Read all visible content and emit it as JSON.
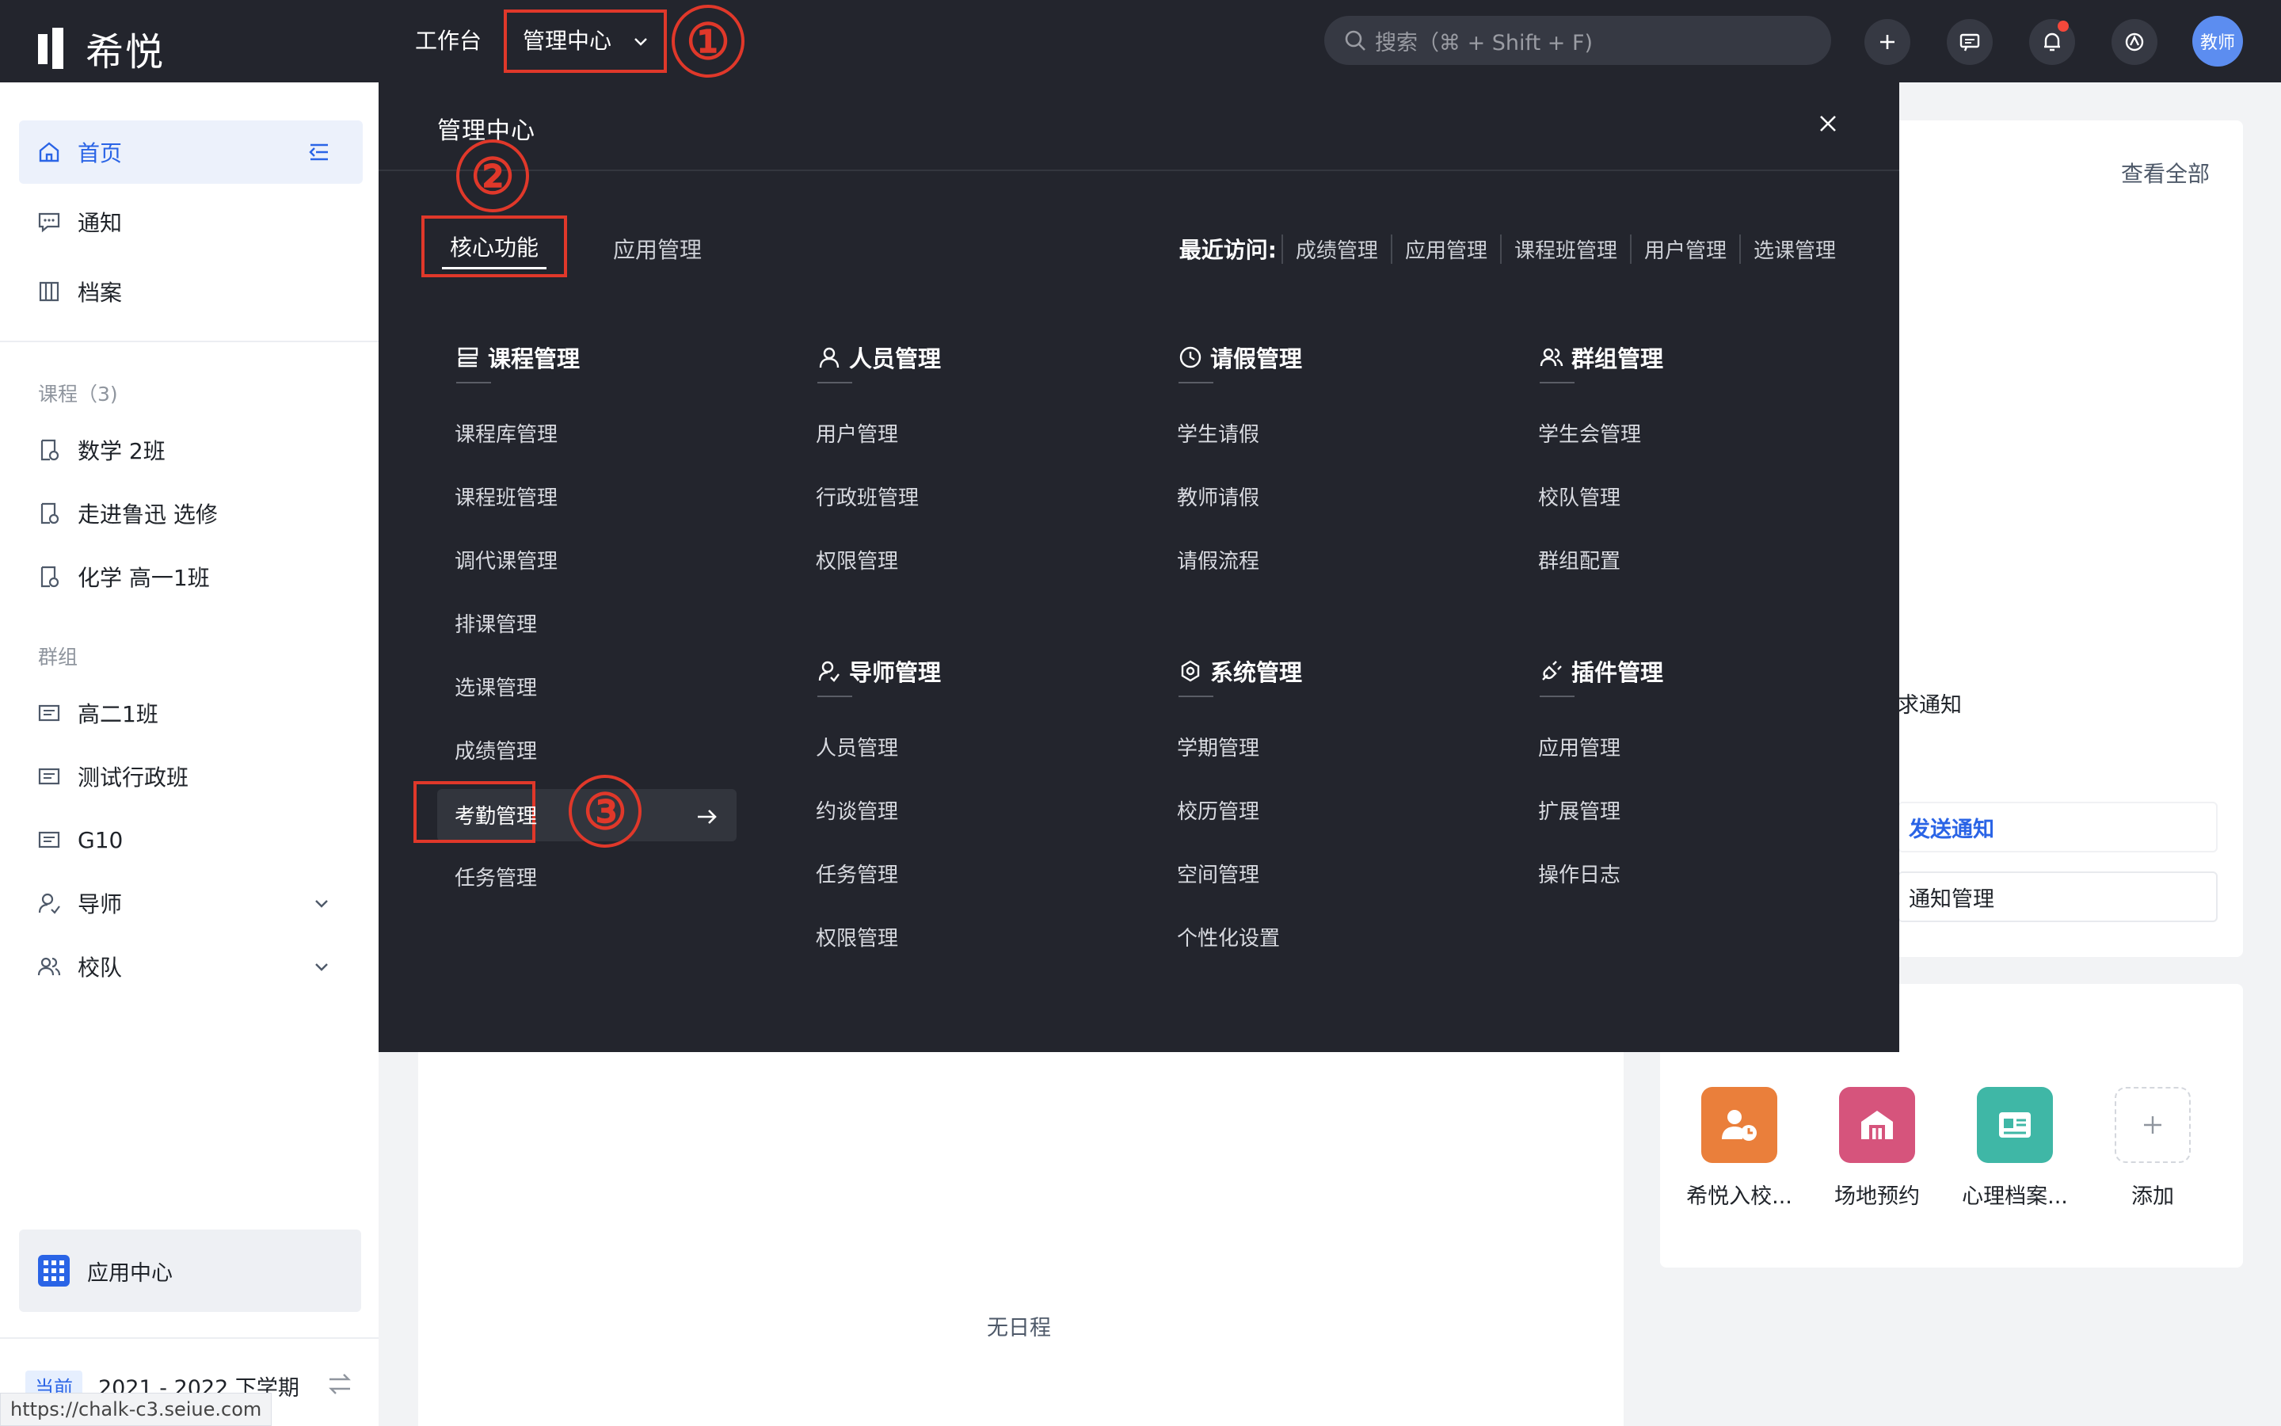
{
  "topbar": {
    "logo_text": "希悦",
    "nav": {
      "workbench": "工作台",
      "admin_center": "管理中心"
    },
    "search_placeholder": "搜索（⌘ + Shift + F)",
    "avatar": "教师",
    "icons": [
      "plus-icon",
      "message-icon",
      "bell-icon",
      "assistant-icon"
    ]
  },
  "annotations": {
    "one": "①",
    "two": "②",
    "three": "③",
    "color": "#e0382a"
  },
  "sidebar": {
    "top_items": [
      {
        "label": "首页",
        "icon": "home-icon",
        "active": true
      },
      {
        "label": "通知",
        "icon": "chat-bubble-icon"
      },
      {
        "label": "档案",
        "icon": "archive-icon"
      }
    ],
    "courses_title": "课程（3)",
    "courses": [
      {
        "label": "数学 2班"
      },
      {
        "label": "走进鲁迅 选修"
      },
      {
        "label": "化学 高一1班"
      }
    ],
    "groups_title": "群组",
    "groups": [
      {
        "label": "高二1班"
      },
      {
        "label": "测试行政班"
      },
      {
        "label": "G10"
      },
      {
        "label": "导师"
      },
      {
        "label": "校队"
      }
    ],
    "app_center": "应用中心",
    "term_badge": "当前",
    "term": "2021 - 2022 下学期",
    "status_url": "https://chalk-c3.seiue.com"
  },
  "main": {
    "no_schedule": "无日程",
    "view_all": "查看全部",
    "request_notice_partial": "求通知",
    "send_notice": "发送通知",
    "notice_manage": "通知管理",
    "apps": [
      {
        "label": "希悦入校...",
        "color": "#ea7f3b"
      },
      {
        "label": "场地预约",
        "color": "#d6547c"
      },
      {
        "label": "心理档案...",
        "color": "#3fb7a6"
      },
      {
        "label": "添加",
        "color": "#ffffff"
      }
    ]
  },
  "menu": {
    "title": "管理中心",
    "tabs": [
      "核心功能",
      "应用管理"
    ],
    "recent_label": "最近访问:",
    "recent": [
      "成绩管理",
      "应用管理",
      "课程班管理",
      "用户管理",
      "选课管理"
    ],
    "categories": {
      "course": {
        "title": "课程管理",
        "items": [
          "课程库管理",
          "课程班管理",
          "调代课管理",
          "排课管理",
          "选课管理",
          "成绩管理",
          "考勤管理",
          "任务管理"
        ]
      },
      "people": {
        "title": "人员管理",
        "items": [
          "用户管理",
          "行政班管理",
          "权限管理"
        ]
      },
      "leave": {
        "title": "请假管理",
        "items": [
          "学生请假",
          "教师请假",
          "请假流程"
        ]
      },
      "group": {
        "title": "群组管理",
        "items": [
          "学生会管理",
          "校队管理",
          "群组配置"
        ]
      },
      "tutor": {
        "title": "导师管理",
        "items": [
          "人员管理",
          "约谈管理",
          "任务管理",
          "权限管理"
        ]
      },
      "system": {
        "title": "系统管理",
        "items": [
          "学期管理",
          "校历管理",
          "空间管理",
          "个性化设置"
        ]
      },
      "plugin": {
        "title": "插件管理",
        "items": [
          "应用管理",
          "扩展管理",
          "操作日志"
        ]
      }
    }
  }
}
